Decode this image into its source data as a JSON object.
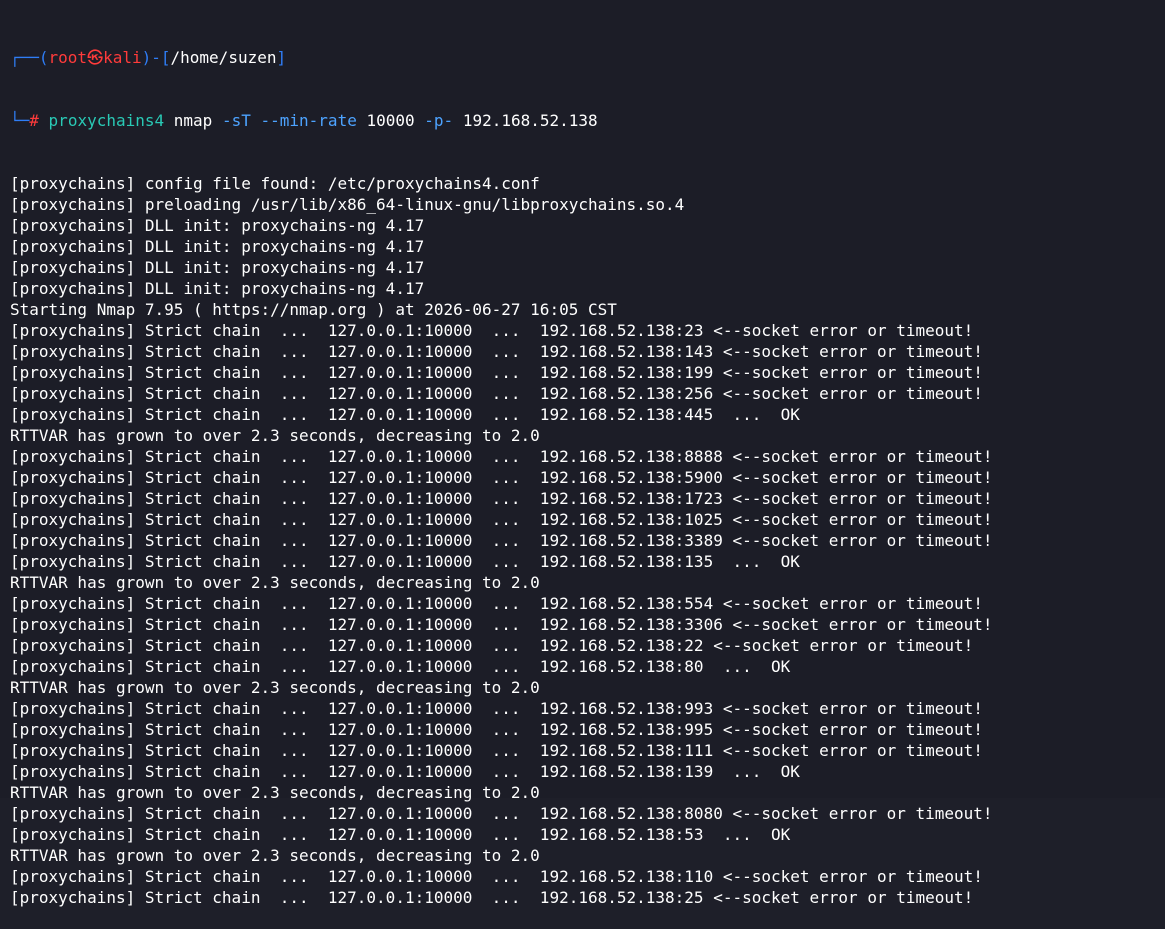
{
  "prompt": {
    "corner_top": "┌──(",
    "user": "root",
    "at_symbol": "㉿",
    "host": "kali",
    "sep": ")-[",
    "path": "/home/suzen",
    "close": "]",
    "corner_bottom": "└─",
    "hash": "#",
    "command": "proxychains4",
    "arg1": "nmap",
    "flag1": "-sT",
    "flag2": "--min-rate",
    "arg2": "10000",
    "flag3": "-p-",
    "target": "192.168.52.138"
  },
  "output_lines": [
    "[proxychains] config file found: /etc/proxychains4.conf",
    "[proxychains] preloading /usr/lib/x86_64-linux-gnu/libproxychains.so.4",
    "[proxychains] DLL init: proxychains-ng 4.17",
    "[proxychains] DLL init: proxychains-ng 4.17",
    "[proxychains] DLL init: proxychains-ng 4.17",
    "[proxychains] DLL init: proxychains-ng 4.17",
    "Starting Nmap 7.95 ( https://nmap.org ) at 2026-06-27 16:05 CST",
    "[proxychains] Strict chain  ...  127.0.0.1:10000  ...  192.168.52.138:23 <--socket error or timeout!",
    "[proxychains] Strict chain  ...  127.0.0.1:10000  ...  192.168.52.138:143 <--socket error or timeout!",
    "[proxychains] Strict chain  ...  127.0.0.1:10000  ...  192.168.52.138:199 <--socket error or timeout!",
    "[proxychains] Strict chain  ...  127.0.0.1:10000  ...  192.168.52.138:256 <--socket error or timeout!",
    "[proxychains] Strict chain  ...  127.0.0.1:10000  ...  192.168.52.138:445  ...  OK",
    "RTTVAR has grown to over 2.3 seconds, decreasing to 2.0",
    "[proxychains] Strict chain  ...  127.0.0.1:10000  ...  192.168.52.138:8888 <--socket error or timeout!",
    "[proxychains] Strict chain  ...  127.0.0.1:10000  ...  192.168.52.138:5900 <--socket error or timeout!",
    "[proxychains] Strict chain  ...  127.0.0.1:10000  ...  192.168.52.138:1723 <--socket error or timeout!",
    "[proxychains] Strict chain  ...  127.0.0.1:10000  ...  192.168.52.138:1025 <--socket error or timeout!",
    "[proxychains] Strict chain  ...  127.0.0.1:10000  ...  192.168.52.138:3389 <--socket error or timeout!",
    "[proxychains] Strict chain  ...  127.0.0.1:10000  ...  192.168.52.138:135  ...  OK",
    "RTTVAR has grown to over 2.3 seconds, decreasing to 2.0",
    "[proxychains] Strict chain  ...  127.0.0.1:10000  ...  192.168.52.138:554 <--socket error or timeout!",
    "[proxychains] Strict chain  ...  127.0.0.1:10000  ...  192.168.52.138:3306 <--socket error or timeout!",
    "[proxychains] Strict chain  ...  127.0.0.1:10000  ...  192.168.52.138:22 <--socket error or timeout!",
    "[proxychains] Strict chain  ...  127.0.0.1:10000  ...  192.168.52.138:80  ...  OK",
    "RTTVAR has grown to over 2.3 seconds, decreasing to 2.0",
    "[proxychains] Strict chain  ...  127.0.0.1:10000  ...  192.168.52.138:993 <--socket error or timeout!",
    "[proxychains] Strict chain  ...  127.0.0.1:10000  ...  192.168.52.138:995 <--socket error or timeout!",
    "[proxychains] Strict chain  ...  127.0.0.1:10000  ...  192.168.52.138:111 <--socket error or timeout!",
    "[proxychains] Strict chain  ...  127.0.0.1:10000  ...  192.168.52.138:139  ...  OK",
    "RTTVAR has grown to over 2.3 seconds, decreasing to 2.0",
    "[proxychains] Strict chain  ...  127.0.0.1:10000  ...  192.168.52.138:8080 <--socket error or timeout!",
    "[proxychains] Strict chain  ...  127.0.0.1:10000  ...  192.168.52.138:53  ...  OK",
    "RTTVAR has grown to over 2.3 seconds, decreasing to 2.0",
    "[proxychains] Strict chain  ...  127.0.0.1:10000  ...  192.168.52.138:110 <--socket error or timeout!",
    "[proxychains] Strict chain  ...  127.0.0.1:10000  ...  192.168.52.138:25 <--socket error or timeout!"
  ],
  "colors": {
    "background": "#1c1d27",
    "prompt_frame": "#2f7df6",
    "prompt_user": "#ff3b3b",
    "command": "#29c9b5",
    "flags": "#4da3ff",
    "text": "#ffffff"
  }
}
